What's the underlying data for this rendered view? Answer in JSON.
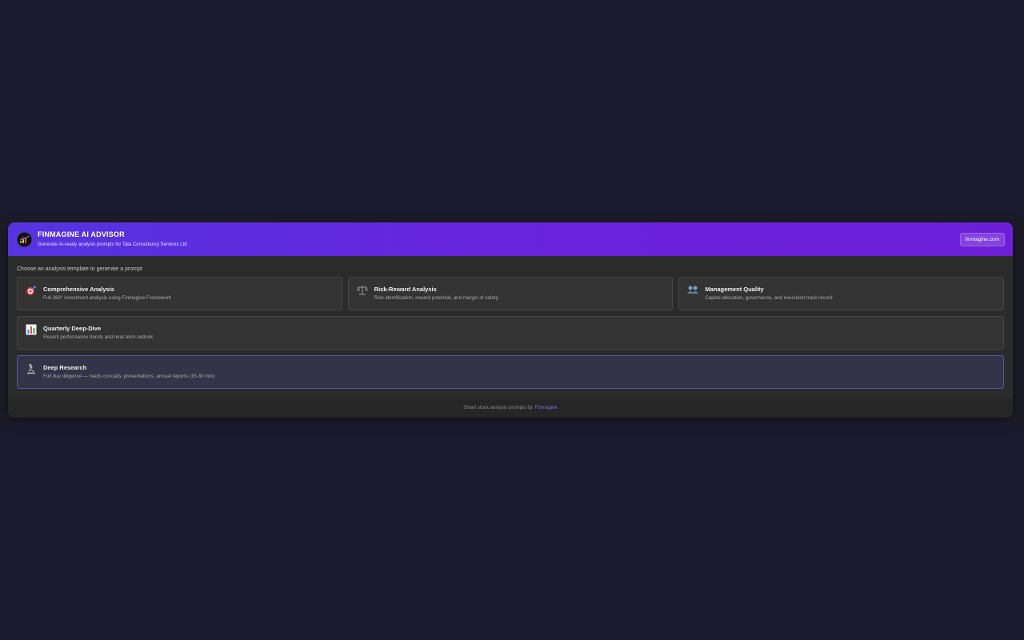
{
  "header": {
    "title": "FINMAGINE AI ADVISOR",
    "subtitle": "Generate AI-ready analysis prompts for Tata Consultancy Services Ltd",
    "site_button": "finmagine.com"
  },
  "instruction": "Choose an analysis template to generate a prompt",
  "templates": [
    {
      "icon": "target-icon",
      "title": "Comprehensive Analysis",
      "desc": "Full 360° investment analysis using Finmagine Framework"
    },
    {
      "icon": "scales-icon",
      "title": "Risk-Reward Analysis",
      "desc": "Risk identification, reward potential, and margin of safety"
    },
    {
      "icon": "people-icon",
      "title": "Management Quality",
      "desc": "Capital allocation, governance, and execution track record"
    },
    {
      "icon": "bar-chart-icon",
      "title": "Quarterly Deep-Dive",
      "desc": "Recent performance trends and near-term outlook"
    },
    {
      "icon": "microscope-icon",
      "title": "Deep Research",
      "desc": "Full due diligence — reads concalls, presentations, annual reports (15-30 min)"
    }
  ],
  "footer": {
    "text": "Smart stock analysis prompts by",
    "link": "Finmagine"
  },
  "colors": {
    "header_start": "#5534e0",
    "header_end": "#6d1fd8",
    "link": "#7b6ef0",
    "highlight_border": "#5b55a6"
  }
}
